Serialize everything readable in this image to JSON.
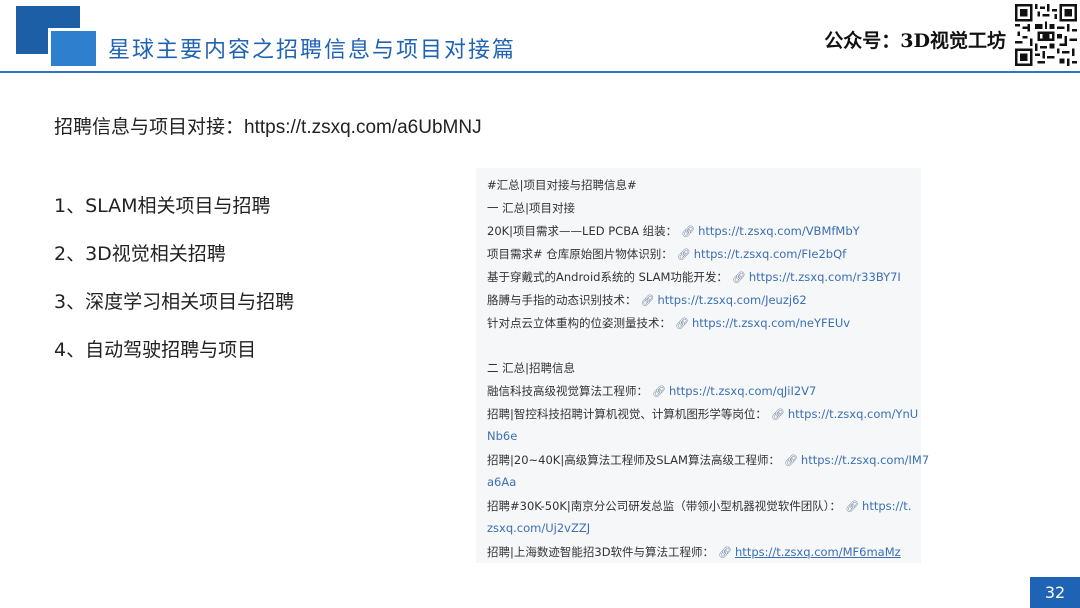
{
  "header": {
    "title": "星球主要内容之招聘信息与项目对接篇",
    "brand": "公众号：3D视觉工坊"
  },
  "subtitle": {
    "label": "招聘信息与项目对接：",
    "url": "https://t.zsxq.com/a6UbMNJ"
  },
  "bullets": [
    "1、SLAM相关项目与招聘",
    "2、3D视觉相关招聘",
    "3、深度学习相关项目与招聘",
    "4、自动驾驶招聘与项目"
  ],
  "panel": {
    "hashtag": "#汇总|项目对接与招聘信息#",
    "section1": "一 汇总|项目对接",
    "items1": [
      {
        "text": "20K|项目需求——LED PCBA 组装：",
        "url": "https://t.zsxq.com/VBMfMbY"
      },
      {
        "text": "项目需求# 仓库原始图片物体识别：",
        "url": "https://t.zsxq.com/FIe2bQf"
      },
      {
        "text": "基于穿戴式的Android系统的 SLAM功能开发：",
        "url": "https://t.zsxq.com/r33BY7I"
      },
      {
        "text": "胳膊与手指的动态识别技术：",
        "url": "https://t.zsxq.com/Jeuzj62"
      },
      {
        "text": "针对点云立体重构的位姿测量技术：",
        "url": "https://t.zsxq.com/neYFEUv"
      }
    ],
    "section2": "二 汇总|招聘信息",
    "job1": {
      "text": "融信科技高级视觉算法工程师：",
      "url": "https://t.zsxq.com/qJiI2V7"
    },
    "job2": {
      "text": "招聘|智控科技招聘计算机视觉、计算机图形学等岗位：",
      "url": "https://t.zsxq.com/YnU",
      "url_cont": "Nb6e"
    },
    "job3": {
      "text": "招聘|20~40K|高级算法工程师及SLAM算法高级工程师：",
      "url": "https://t.zsxq.com/IM7",
      "url_cont": "a6Aa"
    },
    "job4": {
      "text": "招聘#30K-50K|南京分公司研发总监（带领小型机器视觉软件团队）：",
      "url": "https://t.",
      "url_cont": "zsxq.com/Uj2vZZJ"
    },
    "job5": {
      "text": "招聘|上海数迹智能招3D软件与算法工程师：",
      "url": "https://t.zsxq.com/MF6maMz"
    }
  },
  "page_number": "32",
  "colors": {
    "accent_blue": "#1f63b5",
    "link_blue": "#3b6fb3"
  }
}
